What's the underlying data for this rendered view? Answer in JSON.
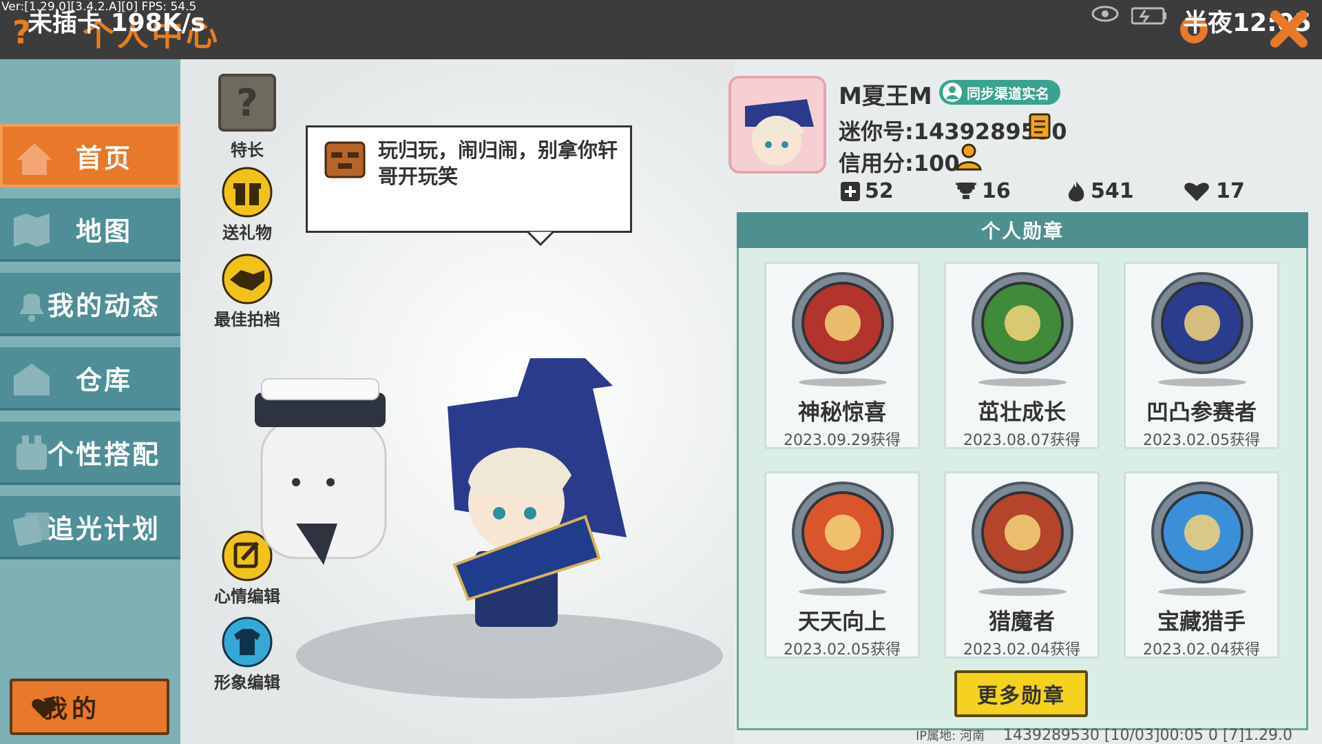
{
  "top_bar": {
    "debug_text": "Ver:[1.29.0][3.4.2.A][0] FPS: 54.5",
    "title": "个人中心",
    "net_status": "未插卡",
    "net_speed": "198K/s",
    "clock": "半夜12:05"
  },
  "sidebar": {
    "items": [
      {
        "label": "首页",
        "icon": "house-icon",
        "active": true
      },
      {
        "label": "地图",
        "icon": "map-icon",
        "active": false
      },
      {
        "label": "我的动态",
        "icon": "bell-icon",
        "active": false
      },
      {
        "label": "仓库",
        "icon": "warehouse-icon",
        "active": false
      },
      {
        "label": "个性搭配",
        "icon": "outfit-icon",
        "active": false
      },
      {
        "label": "追光计划",
        "icon": "cards-icon",
        "active": false
      }
    ],
    "mine_label": "我的"
  },
  "tools": {
    "specialty": "特长",
    "gift": "送礼物",
    "best_shot": "最佳拍档",
    "mood_edit": "心情编辑",
    "image_edit": "形象编辑"
  },
  "bubble": {
    "text": "玩归玩，闹归闹，别拿你轩哥开玩笑"
  },
  "profile": {
    "nickname": "M夏王M",
    "sync_badge": "同步渠道实名",
    "id_label": "迷你号:1439289530",
    "credit_label": "信用分:100",
    "stats": [
      {
        "icon": "plus-box-icon",
        "value": "52"
      },
      {
        "icon": "trophy-icon",
        "value": "16"
      },
      {
        "icon": "flame-icon",
        "value": "541"
      },
      {
        "icon": "heart-icon",
        "value": "17"
      }
    ]
  },
  "medals": {
    "header": "个人勋章",
    "items": [
      {
        "name": "神秘惊喜",
        "date": "2023.09.29获得",
        "color": "#b3342c"
      },
      {
        "name": "茁壮成长",
        "date": "2023.08.07获得",
        "color": "#3f8b3a"
      },
      {
        "name": "凹凸参赛者",
        "date": "2023.02.05获得",
        "color": "#2a3c8c"
      },
      {
        "name": "天天向上",
        "date": "2023.02.05获得",
        "color": "#d9552b"
      },
      {
        "name": "猎魔者",
        "date": "2023.02.04获得",
        "color": "#b4452b"
      },
      {
        "name": "宝藏猎手",
        "date": "2023.02.04获得",
        "color": "#3a8fd8"
      }
    ],
    "more_button": "更多勋章"
  },
  "footer": {
    "ip": "IP属地: 河南",
    "info": "1439289530  [10/03]00:05 0  [7]1.29.0"
  }
}
